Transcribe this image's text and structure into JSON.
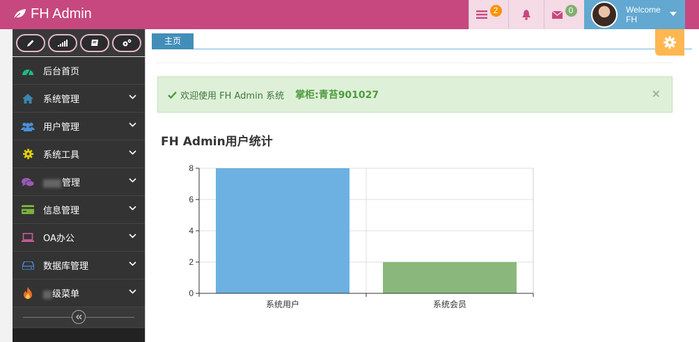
{
  "navbar": {
    "brand": "FH Admin",
    "tasks_badge": "2",
    "messages_badge": "0",
    "welcome": "Welcome",
    "username": "FH"
  },
  "sidebar": {
    "items": [
      {
        "label": "后台首页",
        "icon": "dashboard-icon",
        "color": "#1bbc83",
        "has_children": false
      },
      {
        "label": "系统管理",
        "icon": "home-icon",
        "color": "#3a87ad",
        "has_children": true
      },
      {
        "label": "用户管理",
        "icon": "users-icon",
        "color": "#4a90d9",
        "has_children": true
      },
      {
        "label": "系统工具",
        "icon": "cog-icon",
        "color": "#e3d405",
        "has_children": true
      },
      {
        "label": "管理",
        "icon": "comments-icon",
        "color": "#9b59b6",
        "has_children": true,
        "obscured_prefix": true
      },
      {
        "label": "信息管理",
        "icon": "credit-card-icon",
        "color": "#7ab03e",
        "has_children": true
      },
      {
        "label": "OA办公",
        "icon": "laptop-icon",
        "color": "#d05aa0",
        "has_children": true
      },
      {
        "label": "数据库管理",
        "icon": "hdd-icon",
        "color": "#4a90d9",
        "has_children": true
      },
      {
        "label": "级菜单",
        "icon": "fire-icon",
        "color": "#e8702a",
        "has_children": true,
        "obscured_prefix": true
      }
    ]
  },
  "tabs": [
    {
      "label": "主页"
    }
  ],
  "alert": {
    "message": "欢迎使用 FH Admin 系统",
    "owner": "掌柜:青苔901027",
    "close": "×"
  },
  "chart_title": "FH Admin用户统计",
  "chart_data": {
    "type": "bar",
    "categories": [
      "系统用户",
      "系统会员"
    ],
    "values": [
      8,
      2
    ],
    "colors": [
      "#6cb1e1",
      "#8ab87c"
    ],
    "ylim": [
      0,
      8
    ],
    "yticks": [
      0,
      2,
      4,
      6,
      8
    ],
    "grid": true
  }
}
